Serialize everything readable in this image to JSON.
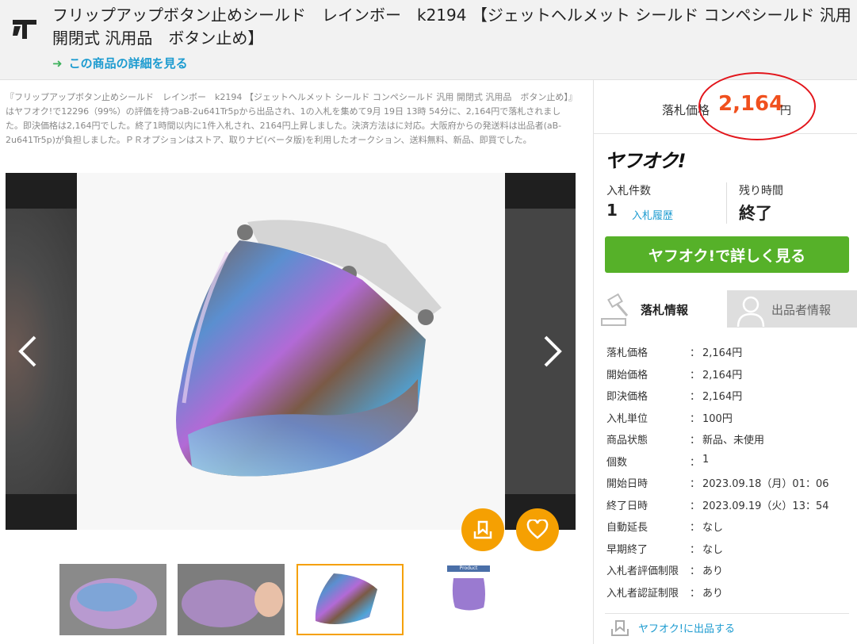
{
  "header": {
    "title": "フリップアップボタン止めシールド　レインボー　k2194 【ジェットヘルメット シールド コンペシールド 汎用 開閉式 汎用品　ボタン止め】",
    "detail_link": "この商品の詳細を見る"
  },
  "summary": "『フリップアップボタン止めシールド　レインボー　k2194 【ジェットヘルメット シールド コンペシールド 汎用 開閉式 汎用品　ボタン止め】』はヤフオク!で12296（99%）の評価を持つaB-2u641Tr5pから出品され、1の入札を集めて9月 19日 13時 54分に、2,164円で落札されました。即決価格は2,164円でした。終了1時間以内に1件入札され、2164円上昇しました。決済方法はに対応。大阪府からの発送料は出品者(aB-2u641Tr5p)が負担しました。ＰＲオプションはストア、取りナビ(ベータ版)を利用したオークション、送料無料、新品、即買でした。",
  "price": {
    "label": "落札価格",
    "value": "2,164",
    "unit": "円"
  },
  "sidebar": {
    "logo": "ヤフオク!",
    "bid_count_label": "入札件数",
    "bid_count": "1",
    "bid_history": "入札履歴",
    "remaining_label": "残り時間",
    "remaining": "終了",
    "cta": "ヤフオク!で詳しく見る",
    "tabs": [
      {
        "label": "落札情報"
      },
      {
        "label": "出品者情報"
      }
    ],
    "info": [
      {
        "key": "落札価格",
        "value": "2,164円"
      },
      {
        "key": "開始価格",
        "value": "2,164円"
      },
      {
        "key": "即決価格",
        "value": "2,164円"
      },
      {
        "key": "入札単位",
        "value": "100円"
      },
      {
        "key": "商品状態",
        "value": "新品、未使用"
      },
      {
        "key": "個数",
        "value": "1"
      },
      {
        "key": "開始日時",
        "value": "2023.09.18（月）01：06"
      },
      {
        "key": "終了日時",
        "value": "2023.09.19（火）13：54"
      },
      {
        "key": "自動延長",
        "value": "なし"
      },
      {
        "key": "早期終了",
        "value": "なし"
      },
      {
        "key": "入札者評価制限",
        "value": "あり"
      },
      {
        "key": "入札者認証制限",
        "value": "あり"
      }
    ],
    "sell_link": "ヤフオク!に出品する"
  },
  "thumb4_caption": "Product parameters",
  "colors": {
    "accent_orange": "#f5a002",
    "price_red": "#f0501e",
    "cta_green": "#56b129",
    "link_blue": "#1c9bd0"
  }
}
